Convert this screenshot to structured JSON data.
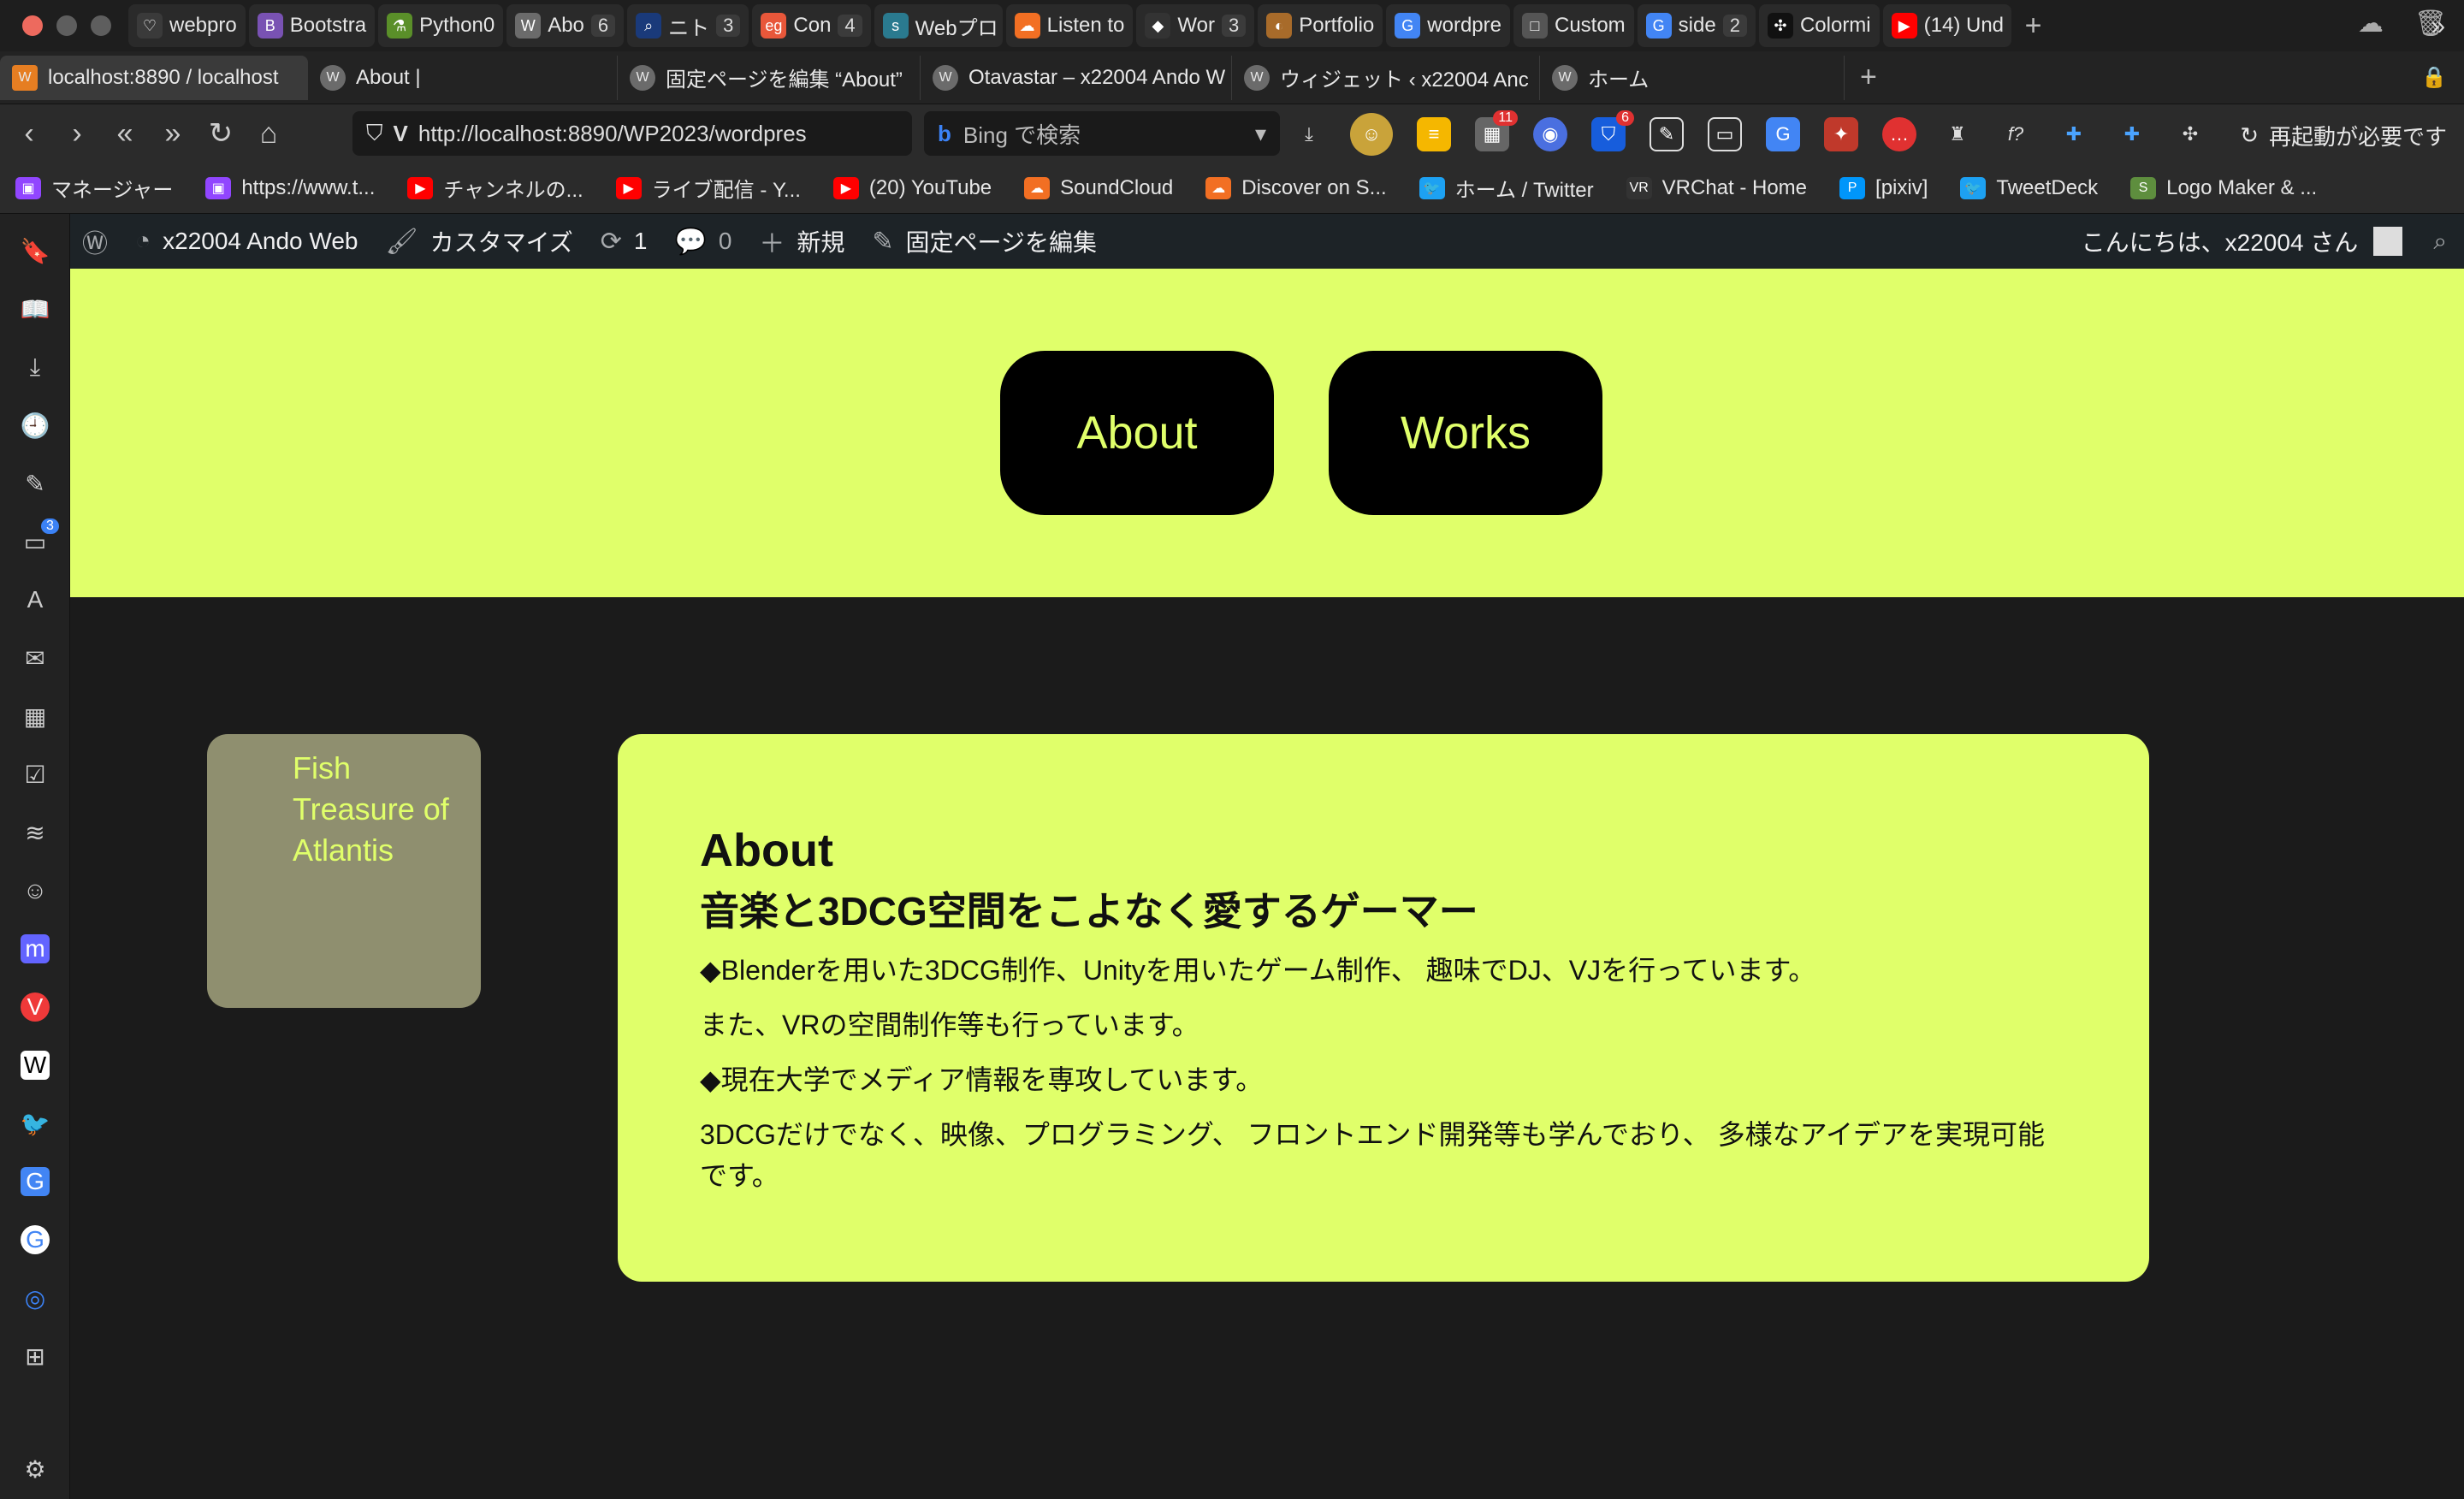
{
  "browser": {
    "tabs_row1": [
      {
        "label": "webpro",
        "icon": "heart-outline-icon",
        "color": "#3a3a3a"
      },
      {
        "label": "Bootstra",
        "icon": "bootstrap-icon",
        "color": "#7952b3"
      },
      {
        "label": "Python0",
        "icon": "python-icon",
        "color": "#5a8f29"
      },
      {
        "label": "Abo",
        "count": "6",
        "icon": "wordpress-icon",
        "color": "#6b6b6b"
      },
      {
        "label": "ニト",
        "count": "3",
        "icon": "search-icon",
        "color": "#1a3a7a"
      },
      {
        "label": "Con",
        "count": "4",
        "icon": "eg-icon",
        "color": "#e8573a"
      },
      {
        "label": "Webプロ",
        "icon": "sp-icon",
        "color": "#2a7a8f"
      },
      {
        "label": "Listen to",
        "icon": "soundcloud-icon",
        "color": "#f26f23"
      },
      {
        "label": "Wor",
        "count": "3",
        "icon": "github-icon",
        "color": "#333"
      },
      {
        "label": "Portfolio",
        "icon": "portfolio-icon",
        "color": "#a86b2a"
      },
      {
        "label": "wordpre",
        "icon": "google-icon",
        "color": "#4285f4"
      },
      {
        "label": "Custom",
        "icon": "custom-icon",
        "color": "#555"
      },
      {
        "label": "side",
        "count": "2",
        "icon": "google-icon",
        "color": "#4285f4"
      },
      {
        "label": "Colormi",
        "icon": "colormind-icon",
        "color": "#111"
      },
      {
        "label": "(14) Und",
        "icon": "youtube-icon",
        "color": "#ff0000"
      }
    ],
    "tabs_row2": [
      {
        "label": "localhost:8890 / localhost",
        "active": true
      },
      {
        "label": "About |"
      },
      {
        "label": "固定ページを編集 “About”"
      },
      {
        "label": "Otavastar – x22004 Ando W"
      },
      {
        "label": "ウィジェット ‹ x22004 Anc"
      },
      {
        "label": "ホーム"
      }
    ],
    "url": "http://localhost:8890/WP2023/wordpres",
    "search_placeholder": "Bing で検索",
    "restart_label": "再起動が必要です",
    "ext_badge_1": "11",
    "ext_badge_2": "6"
  },
  "bookmarks": [
    {
      "label": "マネージャー",
      "icon": "twitch-icon",
      "color": "#9146ff"
    },
    {
      "label": "https://www.t...",
      "icon": "twitch-icon",
      "color": "#9146ff"
    },
    {
      "label": "チャンネルの...",
      "icon": "youtube-icon",
      "color": "#ff0000"
    },
    {
      "label": "ライブ配信 - Y...",
      "icon": "youtube-icon",
      "color": "#ff0000"
    },
    {
      "label": "(20) YouTube",
      "icon": "youtube-icon",
      "color": "#ff0000"
    },
    {
      "label": "SoundCloud",
      "icon": "soundcloud-icon",
      "color": "#f26f23"
    },
    {
      "label": "Discover on S...",
      "icon": "soundcloud-icon",
      "color": "#f26f23"
    },
    {
      "label": "ホーム / Twitter",
      "icon": "twitter-icon",
      "color": "#1da1f2"
    },
    {
      "label": "VRChat - Home",
      "icon": "vrchat-icon",
      "color": "#333"
    },
    {
      "label": "[pixiv]",
      "icon": "pixiv-icon",
      "color": "#0096fa"
    },
    {
      "label": "TweetDeck",
      "icon": "twitter-icon",
      "color": "#1da1f2"
    },
    {
      "label": "Logo Maker & ...",
      "icon": "shopify-icon",
      "color": "#5e8e3e"
    }
  ],
  "sidebar_badge": "3",
  "wpbar": {
    "site_name": "x22004 Ando Web",
    "customize": "カスタマイズ",
    "updates": "1",
    "comments": "0",
    "new": "新規",
    "edit_page": "固定ページを編集",
    "greeting": "こんにちは、x22004 さん"
  },
  "page": {
    "nav": [
      "About",
      "Works"
    ],
    "side_card": [
      "Fish",
      "Treasure of",
      "Atlantis"
    ],
    "about": {
      "title": "About",
      "subtitle": "音楽と3DCG空間をこよなく愛するゲーマー",
      "paragraphs": [
        "◆Blenderを用いた3DCG制作、Unityを用いたゲーム制作、 趣味でDJ、VJを行っています。",
        "また、VRの空間制作等も行っています。",
        "◆現在大学でメディア情報を専攻しています。",
        "3DCGだけでなく、映像、プログラミング、 フロントエンド開発等も学んでおり、 多様なアイデアを実現可能です。"
      ]
    },
    "accent_color": "#e0ff6a"
  }
}
